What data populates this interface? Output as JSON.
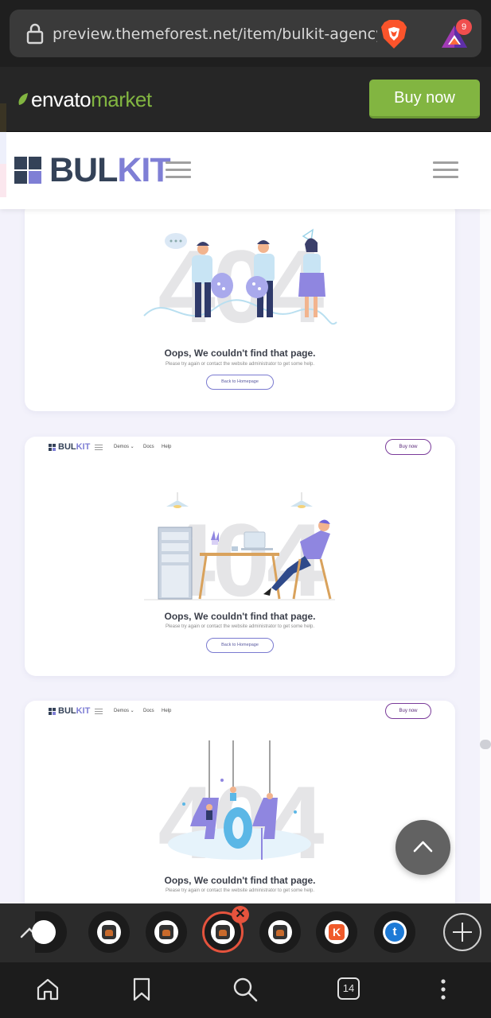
{
  "browser": {
    "url": "preview.themeforest.net/item/bulkit-agency-s",
    "rewards_badge": "9",
    "tab_count": "14"
  },
  "envato": {
    "logo_word1": "envato",
    "logo_word2": "market",
    "buy_now": "Buy now",
    "brand_green": "#82b541"
  },
  "site": {
    "logo_part1": "BUL",
    "logo_part2": "KIT",
    "primary_color": "#344258",
    "accent_color": "#7f7fd5"
  },
  "cards": [
    {
      "has_nav": false,
      "big_text": "404",
      "heading": "Oops, We couldn't find that page.",
      "subtext": "Please try again or contact the website administrator to get some help.",
      "button": "Back to Homepage",
      "illustration": "people-plugging-cable"
    },
    {
      "has_nav": true,
      "nav": {
        "logo_part1": "BUL",
        "logo_part2": "KIT",
        "links": [
          "Demos ⌄",
          "Docs",
          "Help"
        ],
        "buy": "Buy now"
      },
      "big_text": "404",
      "heading": "Oops, We couldn't find that page.",
      "subtext": "Please try again or contact the website administrator to get some help.",
      "button": "Back to Homepage",
      "illustration": "office-desk-lounging"
    },
    {
      "has_nav": true,
      "nav": {
        "logo_part1": "BUL",
        "logo_part2": "KIT",
        "links": [
          "Demos ⌄",
          "Docs",
          "Help"
        ],
        "buy": "Buy now"
      },
      "big_text": "404",
      "heading": "Oops, We couldn't find that page.",
      "subtext": "Please try again or contact the website administrator to get some help.",
      "illustration": "hanging-404-letters"
    }
  ],
  "icons": {
    "lock": "lock-icon",
    "brave": "brave-lion-icon",
    "rewards": "rewards-triangle-icon",
    "scroll_top": "chevron-up-icon",
    "home": "home-icon",
    "bookmark": "bookmark-icon",
    "search": "search-icon",
    "menu": "more-vertical-icon"
  }
}
